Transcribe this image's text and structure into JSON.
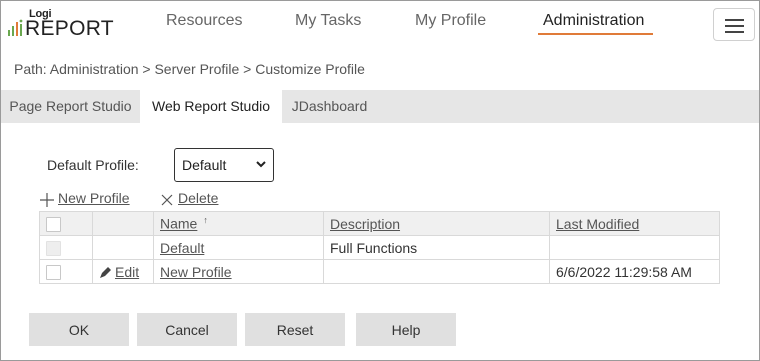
{
  "logo": {
    "small": "Logi",
    "big": "REPORT"
  },
  "nav": {
    "items": [
      "Resources",
      "My Tasks",
      "My Profile",
      "Administration"
    ],
    "active": "Administration",
    "accent_color": "#e07b39"
  },
  "menu_icon": "hamburger-icon",
  "breadcrumb": "Path: Administration > Server Profile > Customize Profile",
  "tabs": [
    "Page Report Studio",
    "Web Report Studio",
    "JDashboard"
  ],
  "active_tab": "Web Report Studio",
  "form": {
    "default_profile_label": "Default Profile:",
    "default_profile_value": "Default"
  },
  "actions": {
    "new_profile": "New Profile",
    "delete": "Delete"
  },
  "table": {
    "columns": [
      "Name",
      "Description",
      "Last Modified"
    ],
    "sorted_by": "Name",
    "sort_direction": "ascending",
    "rows": [
      {
        "edit": "",
        "name": "Default",
        "description": "Full Functions",
        "last_modified": ""
      },
      {
        "edit": "Edit",
        "name": "New Profile",
        "description": "",
        "last_modified": "6/6/2022 11:29:58 AM"
      }
    ]
  },
  "buttons": {
    "ok": "OK",
    "cancel": "Cancel",
    "reset": "Reset",
    "help": "Help"
  }
}
